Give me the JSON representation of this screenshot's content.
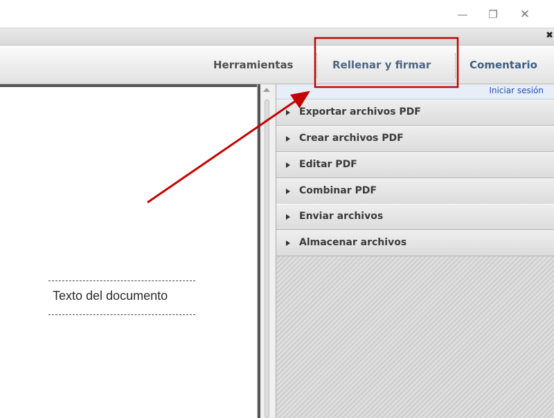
{
  "window": {
    "controls": {
      "minimize_glyph": "—",
      "maximize_glyph": "❐",
      "close_glyph": "✕"
    },
    "doc_close_glyph": "✖"
  },
  "toolbar": {
    "tabs": [
      {
        "label": "Herramientas"
      },
      {
        "label": "Rellenar y firmar"
      },
      {
        "label": "Comentario"
      }
    ]
  },
  "document": {
    "text": "Texto del documento"
  },
  "pane": {
    "login_label": "Iniciar sesión",
    "items": [
      {
        "label": "Exportar archivos PDF"
      },
      {
        "label": "Crear archivos PDF"
      },
      {
        "label": "Editar PDF"
      },
      {
        "label": "Combinar PDF"
      },
      {
        "label": "Enviar archivos"
      },
      {
        "label": "Almacenar archivos"
      }
    ]
  },
  "colors": {
    "highlight": "#c40000",
    "arrow": "#c40000",
    "link": "#1f4fb3"
  },
  "icons": {
    "minimize": "minimize-icon",
    "maximize": "maximize-icon",
    "close": "close-icon",
    "expand": "triangle-right-icon"
  }
}
